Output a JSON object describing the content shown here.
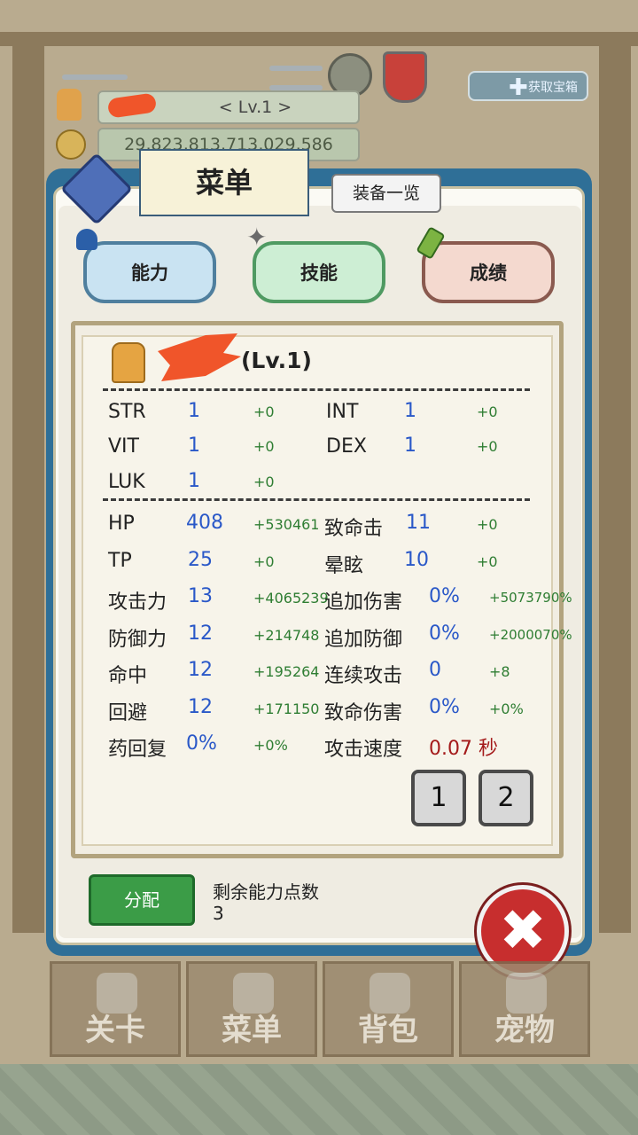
{
  "hud": {
    "name_level": "< Lv.1 >",
    "gold": "29,823,813,713,029,586",
    "bonus_label": "获取宝箱"
  },
  "menu": {
    "title": "菜单",
    "equip_button": "装备一览",
    "tabs": [
      "能力",
      "技能",
      "成绩"
    ]
  },
  "character": {
    "level_label": "(Lv.1)"
  },
  "stats": {
    "str": {
      "label": "STR",
      "value": "1",
      "bonus": "+0"
    },
    "int": {
      "label": "INT",
      "value": "1",
      "bonus": "+0"
    },
    "vit": {
      "label": "VIT",
      "value": "1",
      "bonus": "+0"
    },
    "dex": {
      "label": "DEX",
      "value": "1",
      "bonus": "+0"
    },
    "luk": {
      "label": "LUK",
      "value": "1",
      "bonus": "+0"
    },
    "hp": {
      "label": "HP",
      "value": "408",
      "bonus": "+530461"
    },
    "crit": {
      "label": "致命击",
      "value": "11",
      "bonus": "+0"
    },
    "tp": {
      "label": "TP",
      "value": "25",
      "bonus": "+0"
    },
    "stun": {
      "label": "晕眩",
      "value": "10",
      "bonus": "+0"
    },
    "atk": {
      "label": "攻击力",
      "value": "13",
      "bonus": "+4065239"
    },
    "extra_dmg": {
      "label": "追加伤害",
      "value": "0%",
      "bonus": "+5073790%"
    },
    "def": {
      "label": "防御力",
      "value": "12",
      "bonus": "+214748"
    },
    "extra_def": {
      "label": "追加防御",
      "value": "0%",
      "bonus": "+2000070%"
    },
    "hit": {
      "label": "命中",
      "value": "12",
      "bonus": "+195264"
    },
    "combo": {
      "label": "连续攻击",
      "value": "0",
      "bonus": "+8"
    },
    "eva": {
      "label": "回避",
      "value": "12",
      "bonus": "+171150"
    },
    "crit_dmg": {
      "label": "致命伤害",
      "value": "0%",
      "bonus": "+0%"
    },
    "potion": {
      "label": "药回复",
      "value": "0%",
      "bonus": "+0%"
    },
    "atk_speed": {
      "label": "攻击速度",
      "value": "0.07 秒"
    }
  },
  "pages": [
    "1",
    "2"
  ],
  "footer": {
    "assign_button": "分配",
    "remaining_label": "剩余能力点数",
    "remaining_value": "3"
  },
  "close_symbol": "✖",
  "nav": [
    "关卡",
    "菜单",
    "背包",
    "宠物"
  ],
  "colors": {
    "panel_border": "#2f6f97",
    "stat_value": "#2a58c8",
    "stat_bonus": "#2e7d32",
    "speed_value": "#a41a1a",
    "assign_button": "#3b9c47",
    "close_button": "#c72e2e"
  }
}
